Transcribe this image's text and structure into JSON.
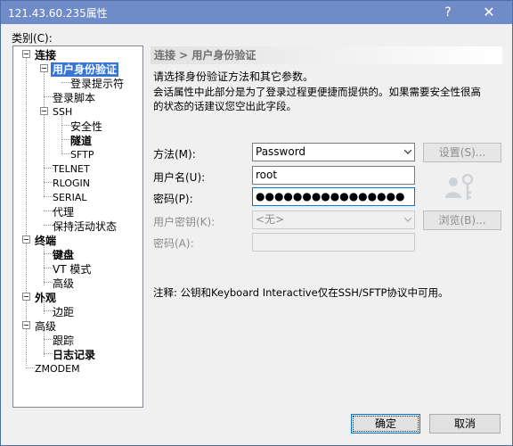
{
  "titlebar": {
    "title": "121.43.60.235属性",
    "help_glyph": "?",
    "close_glyph": "✕"
  },
  "category_label": "类别(C):",
  "tree": [
    {
      "label": "连接",
      "bold": true
    },
    {
      "label": "用户身份验证",
      "bold": true,
      "selected": true
    },
    {
      "label": "登录提示符"
    },
    {
      "label": "登录脚本"
    },
    {
      "label": "SSH"
    },
    {
      "label": "安全性"
    },
    {
      "label": "隧道",
      "bold": true
    },
    {
      "label": "SFTP"
    },
    {
      "label": "TELNET"
    },
    {
      "label": "RLOGIN"
    },
    {
      "label": "SERIAL"
    },
    {
      "label": "代理"
    },
    {
      "label": "保持活动状态"
    },
    {
      "label": "终端",
      "bold": true
    },
    {
      "label": "键盘",
      "bold": true
    },
    {
      "label": "VT 模式"
    },
    {
      "label": "高级"
    },
    {
      "label": "外观",
      "bold": true
    },
    {
      "label": "边距"
    },
    {
      "label": "高级"
    },
    {
      "label": "跟踪"
    },
    {
      "label": "日志记录",
      "bold": true
    },
    {
      "label": "ZMODEM"
    }
  ],
  "panel": {
    "header": "连接 > 用户身份验证",
    "desc1": "请选择身份验证方法和其它参数。",
    "desc2": "会话属性中此部分是为了登录过程更便捷而提供的。如果需要安全性很高",
    "desc3": "的状态的话建议您空出此字段。",
    "method_label": "方法(M):",
    "method_value": "Password",
    "settings_button": "设置(S)...",
    "username_label": "用户名(U):",
    "username_value": "root",
    "password_label": "密码(P):",
    "password_value": "●●●●●●●●●●●●●●●●",
    "userkey_label": "用户密钥(K):",
    "userkey_value": "<无>",
    "browse_button": "浏览(B)...",
    "passphrase_label": "密码(A):",
    "note": "注释: 公钥和Keyboard Interactive仅在SSH/SFTP协议中可用。"
  },
  "footer": {
    "ok": "确定",
    "cancel": "取消"
  },
  "colors": {
    "titlebar": "#6f8cc8",
    "selection": "#3875d7",
    "accent_border": "#0078d7"
  }
}
